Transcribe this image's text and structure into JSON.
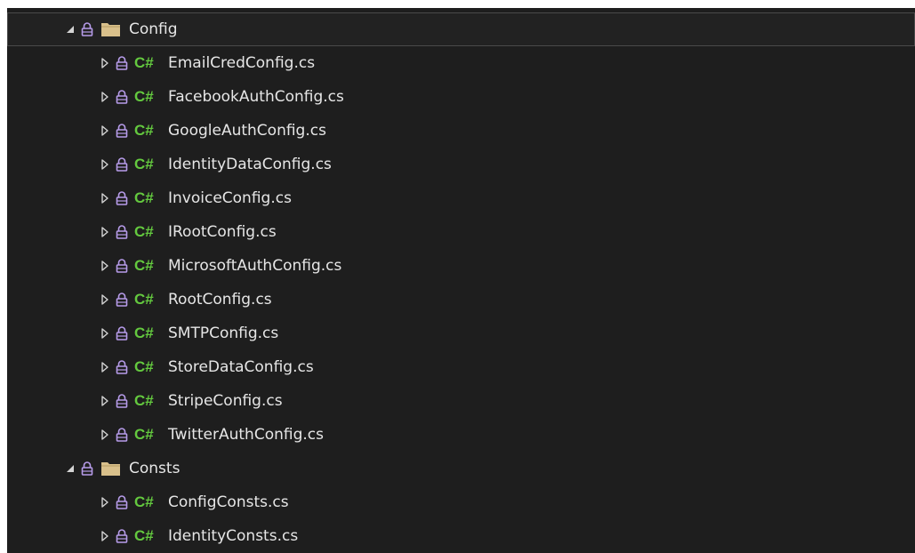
{
  "colors": {
    "background": "#1e1e1e",
    "text": "#e6e6e6",
    "icon": "#bbbbbb",
    "csharp": "#64c93f",
    "folder": "#d9c08b",
    "lock": "#b79cea"
  },
  "tree": {
    "folders": [
      {
        "name": "Config",
        "expanded": true,
        "selected": true,
        "files": [
          "EmailCredConfig.cs",
          "FacebookAuthConfig.cs",
          "GoogleAuthConfig.cs",
          "IdentityDataConfig.cs",
          "InvoiceConfig.cs",
          "IRootConfig.cs",
          "MicrosoftAuthConfig.cs",
          "RootConfig.cs",
          "SMTPConfig.cs",
          "StoreDataConfig.cs",
          "StripeConfig.cs",
          "TwitterAuthConfig.cs"
        ]
      },
      {
        "name": "Consts",
        "expanded": true,
        "selected": false,
        "files": [
          "ConfigConsts.cs",
          "IdentityConsts.cs"
        ]
      }
    ],
    "file_badge": "C#"
  }
}
